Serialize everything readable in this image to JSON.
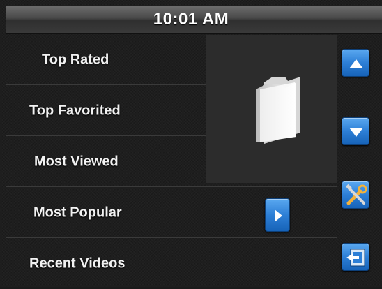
{
  "status_bar": {
    "time": "10:01 AM"
  },
  "menu": {
    "items": [
      {
        "label": "Top Rated"
      },
      {
        "label": "Top Favorited"
      },
      {
        "label": "Most Viewed"
      },
      {
        "label": "Most Popular"
      },
      {
        "label": "Recent Videos"
      }
    ]
  },
  "preview": {
    "icon": "folder-icon"
  },
  "sidebar": {
    "buttons": [
      {
        "icon": "arrow-up-icon"
      },
      {
        "icon": "arrow-down-icon"
      },
      {
        "icon": "tools-icon"
      },
      {
        "icon": "exit-icon"
      }
    ]
  },
  "selected_item_action": {
    "icon": "play-icon"
  },
  "colors": {
    "accent": "#2d7fd6",
    "background": "#1e1e1e",
    "text": "#f2f2f2"
  }
}
